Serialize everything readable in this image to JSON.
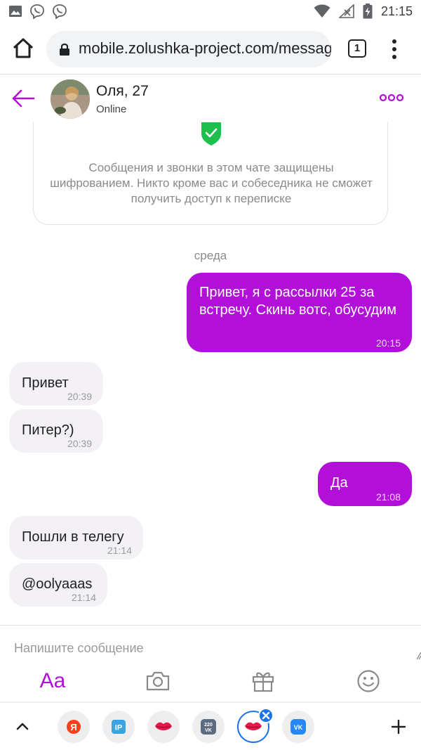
{
  "status_bar": {
    "time": "21:15",
    "icons": [
      "image-icon",
      "viber-icon",
      "viber-icon",
      "wifi-icon",
      "no-signal-icon",
      "battery-charging-icon"
    ]
  },
  "browser": {
    "url": "mobile.zolushka-project.com/messag",
    "tab_count": "1"
  },
  "chat_header": {
    "name": "Оля, 27",
    "status": "Online"
  },
  "encryption_notice": {
    "text": "Сообщения и звонки в этом чате защищены шифрованием. Никто кроме вас и собеседника не сможет получить доступ к переписке"
  },
  "day_label": "среда",
  "messages": [
    {
      "direction": "out",
      "text": "Привет, я с рассылки 25 за встречу. Скинь вотс, обусудим",
      "time": "20:15"
    },
    {
      "direction": "in",
      "text": "Привет",
      "time": "20:39"
    },
    {
      "direction": "in",
      "text": "Питер?)",
      "time": "20:39"
    },
    {
      "direction": "out",
      "text": "Да",
      "time": "21:08"
    },
    {
      "direction": "in",
      "text": "Пошли в телегу",
      "time": "21:14"
    },
    {
      "direction": "in",
      "text": "@oolyaaas",
      "time": "21:14"
    }
  ],
  "composer": {
    "placeholder": "Напишите сообщение",
    "text_style_label": "Aa"
  },
  "bottom_apps": [
    {
      "name": "yandex",
      "glyph": "Я",
      "color": "#fc3f1d"
    },
    {
      "name": "ip-app",
      "glyph": "IP",
      "color": "#3aa3e3"
    },
    {
      "name": "lips-app",
      "glyph": "",
      "color": "#e6194b"
    },
    {
      "name": "220vk",
      "glyph": "220 VK",
      "color": "#5b6b80"
    },
    {
      "name": "lips-app-active",
      "glyph": "",
      "color": "#e6194b"
    },
    {
      "name": "vk",
      "glyph": "VK",
      "color": "#2787f5"
    }
  ],
  "colors": {
    "accent": "#b20fd9",
    "incoming_bubble": "#f4f1f6",
    "secure_green": "#1fbf4e",
    "active_app_ring": "#1a73e8"
  }
}
